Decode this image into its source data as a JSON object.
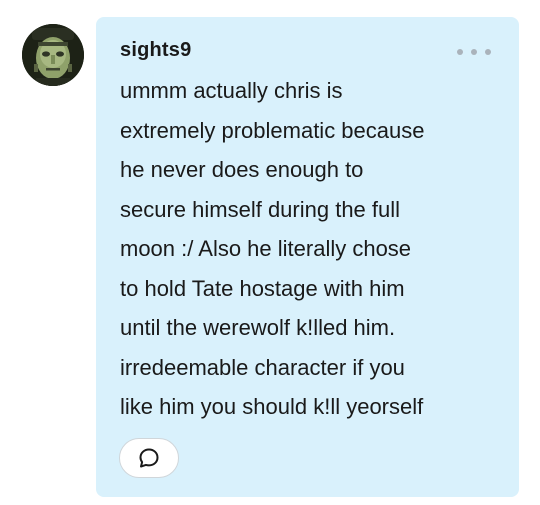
{
  "reply": {
    "username": "sights9",
    "avatar_icon": "frankenstein-face-avatar",
    "more_icon": "ellipsis-icon",
    "comment_icon": "speech-bubble-icon",
    "lines": [
      "ummm actually chris is",
      "extremely problematic because",
      "he never does enough to",
      "secure himself during the full",
      "moon :/ Also he literally chose",
      "to hold Tate hostage with him",
      "until the werewolf k!lled him.",
      "irredeemable character if you",
      "like him you should k!ll yeorself"
    ]
  },
  "colors": {
    "card_background": "#d9f1fc",
    "text": "#1a1a1a",
    "muted_icon": "#aab3bb"
  }
}
